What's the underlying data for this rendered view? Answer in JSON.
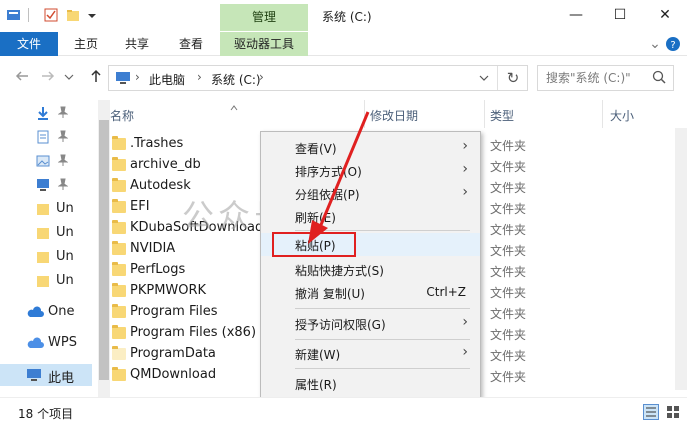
{
  "titlebar": {
    "manage_label": "管理",
    "window_title": "系统 (C:)",
    "minimize": "—",
    "maximize": "☐",
    "close": "✕"
  },
  "ribbon": {
    "tabs": [
      "文件",
      "主页",
      "共享",
      "查看",
      "驱动器工具"
    ],
    "expand": "⌄",
    "help": "?"
  },
  "address": {
    "crumbs": [
      "此电脑",
      "系统 (C:)"
    ],
    "sep": "›",
    "refresh": "↻",
    "search_placeholder": "搜索\"系统 (C:)\""
  },
  "nav": {
    "items": [
      {
        "label": "",
        "icon": "download-icon",
        "pin": true
      },
      {
        "label": "",
        "icon": "document-icon",
        "pin": true
      },
      {
        "label": "",
        "icon": "picture-icon",
        "pin": true
      },
      {
        "label": "",
        "icon": "desktop-icon",
        "pin": true
      },
      {
        "label": "Un",
        "icon": "folder-icon"
      },
      {
        "label": "Un",
        "icon": "folder-icon"
      },
      {
        "label": "Un",
        "icon": "folder-icon"
      },
      {
        "label": "Un",
        "icon": "folder-icon"
      },
      {
        "label": "One",
        "icon": "cloud-icon"
      },
      {
        "label": "WPS",
        "icon": "wps-cloud-icon"
      },
      {
        "label": "此电",
        "icon": "pc-icon"
      }
    ]
  },
  "columns": {
    "name": "名称",
    "modified": "修改日期",
    "type": "类型",
    "size": "大小"
  },
  "files": [
    {
      "name": ".Trashes",
      "type": "文件夹"
    },
    {
      "name": "archive_db",
      "type": "文件夹"
    },
    {
      "name": "Autodesk",
      "type": "文件夹"
    },
    {
      "name": "EFI",
      "type": "文件夹"
    },
    {
      "name": "KDubaSoftDownloads",
      "type": "文件夹"
    },
    {
      "name": "NVIDIA",
      "type": "文件夹"
    },
    {
      "name": "PerfLogs",
      "type": "文件夹"
    },
    {
      "name": "PKPMWORK",
      "type": "文件夹"
    },
    {
      "name": "Program Files",
      "type": "文件夹"
    },
    {
      "name": "Program Files (x86)",
      "type": "文件夹"
    },
    {
      "name": "ProgramData",
      "type": "文件夹"
    },
    {
      "name": "QMDownload",
      "type": "文件夹"
    }
  ],
  "context_menu": {
    "view": "查看(V)",
    "sort": "排序方式(O)",
    "group": "分组依据(P)",
    "refresh": "刷新(E)",
    "paste": "粘贴(P)",
    "paste_shortcut": "粘贴快捷方式(S)",
    "undo_copy": "撤消 复制(U)",
    "undo_shortcut": "Ctrl+Z",
    "grant_access": "授予访问权限(G)",
    "new": "新建(W)",
    "properties": "属性(R)",
    "submenu_arrow": "›"
  },
  "watermark": "公众号 · 开源神器",
  "status": {
    "count": "18 个项目"
  },
  "colors": {
    "accent": "#1a6fc4",
    "manage": "#c6e6b8",
    "highlight": "#e02020"
  }
}
